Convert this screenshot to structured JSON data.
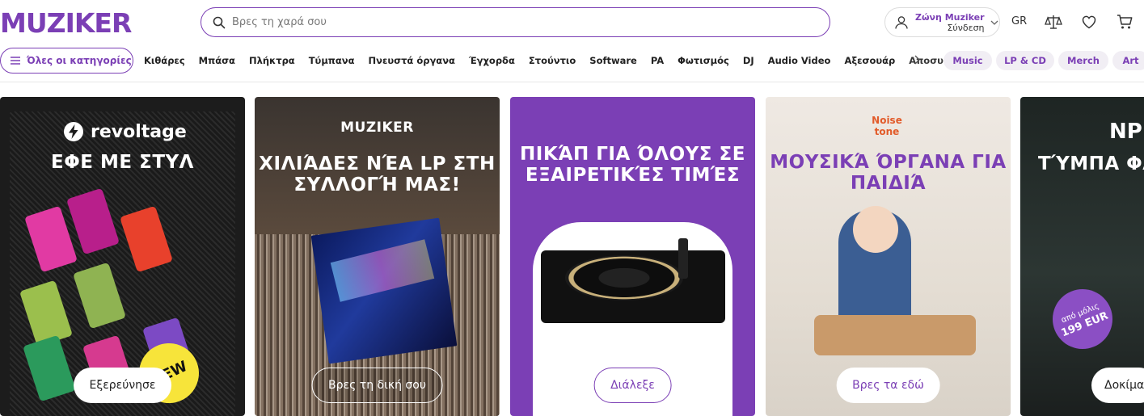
{
  "header": {
    "logo_text": "MUZIKER",
    "search": {
      "placeholder": "Βρες τη χαρά σου"
    },
    "account": {
      "title": "Ζώνη Muziker",
      "subtitle": "Σύνδεση"
    },
    "language": "GR",
    "icons": [
      "compare-icon",
      "heart-icon",
      "cart-icon"
    ]
  },
  "nav": {
    "all_categories": "Όλες οι κατηγορίες",
    "categories": [
      "Κιθάρες",
      "Μπάσα",
      "Πλήκτρα",
      "Τύμπανα",
      "Πνευστά όργανα",
      "Έγχορδα",
      "Στούντιο",
      "Software",
      "PA",
      "Φωτισμός",
      "DJ",
      "Audio Video",
      "Αξεσουάρ"
    ],
    "truncated_category": "Αποσυσκευα",
    "pills": [
      "Music",
      "LP & CD",
      "Merch",
      "Art"
    ]
  },
  "banners": [
    {
      "brand": "revoltage",
      "title": "ΕΦΕ ΜΕ ΣΤΥΛ",
      "badge": "NEW",
      "button": "Εξερεύνησε"
    },
    {
      "brand": "MUZIKER",
      "title": "ΧΙΛΙΆΔΕΣ ΝΈΑ LP ΣΤΗ ΣΥΛΛΟΓΉ ΜΑΣ!",
      "button": "Βρες τη δική σου"
    },
    {
      "title": "ΠΙΚΆΠ ΓΙΑ ΌΛΟΥΣ ΣΕ ΕΞΑΙΡΕΤΙΚΈΣ ΤΙΜΈΣ",
      "button": "Διάλεξε"
    },
    {
      "brand": "Noise tone",
      "title": "ΜΟΥΣΙΚΆ ΌΡΓΑΝΑ ΓΙΑ ΠΑΙΔΙΆ",
      "button": "Βρες τα εδώ"
    },
    {
      "brand": "NP",
      "title": "ΤΎΜΠΑ ΦΑΝΤΑΣΤΙΚ",
      "badge_line1": "από μόλις",
      "badge_line2": "199 EUR",
      "button": "Δοκίμα"
    }
  ],
  "colors": {
    "brand_purple": "#7b3fb5",
    "pill_bg": "#f1eef4",
    "badge_yellow": "#f7e43a"
  }
}
